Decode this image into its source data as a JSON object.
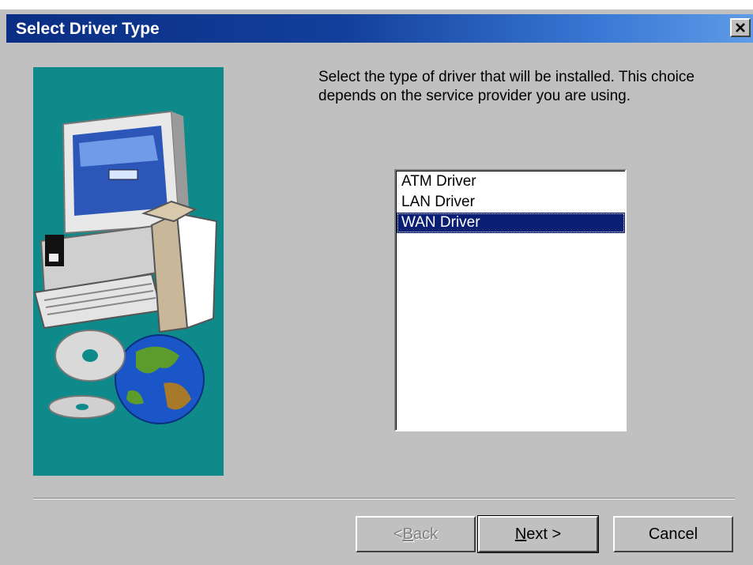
{
  "window": {
    "title": "Select Driver Type",
    "close_glyph": "✕"
  },
  "instruction": "Select the type of driver that will be installed.  This choice depends on the service provider you are using.",
  "listbox": {
    "items": [
      "ATM Driver",
      "LAN Driver",
      "WAN Driver"
    ],
    "selected": "WAN Driver"
  },
  "buttons": {
    "back": {
      "mnemonic": "B",
      "before": "< ",
      "after": "ack",
      "enabled": false
    },
    "next": {
      "mnemonic": "N",
      "before": "",
      "after": "ext >",
      "enabled": true
    },
    "cancel": {
      "label": "Cancel",
      "enabled": true
    }
  },
  "illustration": {
    "icons": [
      "computer-monitor-icon",
      "box-icon",
      "keyboard-icon",
      "cd-icon",
      "globe-icon"
    ]
  },
  "colors": {
    "title_start": "#0a2e83",
    "title_end": "#5f9be6",
    "panel": "#0e8a8a",
    "selection": "#0a1f74",
    "face": "#c0c0c0"
  }
}
